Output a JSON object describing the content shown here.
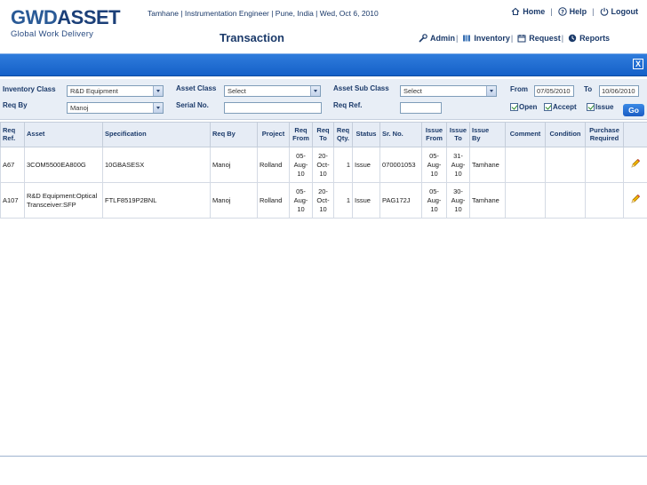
{
  "header": {
    "logo_gwd": "GWD",
    "logo_asset": "ASSET",
    "logo_sub": "Global Work Delivery",
    "user_info": "Tamhane | Instrumentation Engineer | Pune, India | Wed, Oct 6, 2010",
    "page_title": "Transaction",
    "top_nav": {
      "home": "Home",
      "help": "Help",
      "logout": "Logout"
    },
    "sub_nav": {
      "admin": "Admin",
      "inventory": "Inventory",
      "request": "Request",
      "reports": "Reports"
    }
  },
  "bluebar": {
    "close_label": "X"
  },
  "filters": {
    "inventory_class_label": "Inventory Class",
    "inventory_class_value": "R&D Equipment",
    "asset_class_label": "Asset Class",
    "asset_class_value": "Select",
    "asset_sub_class_label": "Asset Sub Class",
    "asset_sub_class_value": "Select",
    "from_label": "From",
    "from_value": "07/05/2010",
    "to_label": "To",
    "to_value": "10/06/2010",
    "req_by_label": "Req By",
    "req_by_value": "Manoj",
    "serial_no_label": "Serial No.",
    "serial_no_value": "",
    "req_ref_label": "Req Ref.",
    "req_ref_value": "",
    "open_label": "Open",
    "accept_label": "Accept",
    "issue_label": "Issue",
    "go_label": "Go"
  },
  "table": {
    "headers": {
      "req_ref_1": "Req",
      "req_ref_2": "Ref.",
      "asset": "Asset",
      "specification": "Specification",
      "req_by": "Req By",
      "project": "Project",
      "req_from_1": "Req",
      "req_from_2": "From",
      "req_to_1": "Req",
      "req_to_2": "To",
      "req_qty_1": "Req",
      "req_qty_2": "Qty.",
      "status": "Status",
      "sr_no": "Sr. No.",
      "issue_from_1": "Issue",
      "issue_from_2": "From",
      "issue_to_1": "Issue",
      "issue_to_2": "To",
      "issue_by_1": "Issue",
      "issue_by_2": "By",
      "comment": "Comment",
      "condition": "Condition",
      "purchase_required_1": "Purchase",
      "purchase_required_2": "Required"
    },
    "rows": [
      {
        "req_ref": "A67",
        "asset": "3COM5500EA800G",
        "specification": "10GBASESX",
        "req_by": "Manoj",
        "project": "Rolland",
        "req_from": [
          "05-",
          "Aug-",
          "10"
        ],
        "req_to": [
          "20-",
          "Oct-",
          "10"
        ],
        "req_qty": "1",
        "status": "Issue",
        "sr_no": "070001053",
        "issue_from": [
          "05-",
          "Aug-",
          "10"
        ],
        "issue_to": [
          "31-",
          "Aug-",
          "10"
        ],
        "issue_by": "Tamhane",
        "comment": "",
        "condition": "",
        "purchase_required": ""
      },
      {
        "req_ref": "A107",
        "asset": "R&D Equipment:Optical Transceiver:SFP",
        "specification": "FTLF8519P2BNL",
        "req_by": "Manoj",
        "project": "Rolland",
        "req_from": [
          "05-",
          "Aug-",
          "10"
        ],
        "req_to": [
          "20-",
          "Oct-",
          "10"
        ],
        "req_qty": "1",
        "status": "Issue",
        "sr_no": "PAG172J",
        "issue_from": [
          "05-",
          "Aug-",
          "10"
        ],
        "issue_to": [
          "30-",
          "Aug-",
          "10"
        ],
        "issue_by": "Tamhane",
        "comment": "",
        "condition": "",
        "purchase_required": ""
      }
    ]
  },
  "colors": {
    "brand_blue": "#1560c8",
    "header_text": "#1b3a6a",
    "edit_icon": "#e8a800"
  },
  "icons": [
    "home-icon",
    "help-icon",
    "logout-icon",
    "admin-icon",
    "inventory-icon",
    "request-icon",
    "reports-icon",
    "pencil-icon",
    "close-icon"
  ]
}
